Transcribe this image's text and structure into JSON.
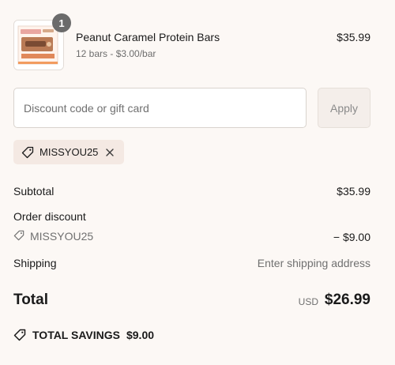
{
  "product": {
    "quantity": "1",
    "name": "Peanut Caramel Protein Bars",
    "variant": "12 bars - $3.00/bar",
    "price": "$35.99",
    "thumbnail_icon": "protein-bar-box-image"
  },
  "discount": {
    "placeholder": "Discount code or gift card",
    "apply_label": "Apply",
    "applied_code": "MISSYOU25",
    "tag_icon": "tag-icon",
    "remove_icon": "close-icon"
  },
  "summary": {
    "subtotal_label": "Subtotal",
    "subtotal_value": "$35.99",
    "order_discount_label": "Order discount",
    "discount_code": "MISSYOU25",
    "discount_value": "− $9.00",
    "shipping_label": "Shipping",
    "shipping_value": "Enter shipping address",
    "total_label": "Total",
    "currency": "USD",
    "total_value": "$26.99",
    "savings_label": "TOTAL SAVINGS",
    "savings_value": "$9.00"
  },
  "colors": {
    "background": "#fcf8f5",
    "chip_background": "#f4e9e3",
    "text": "#1a1a1a",
    "muted": "#707070",
    "badge": "#6b6b6b"
  }
}
